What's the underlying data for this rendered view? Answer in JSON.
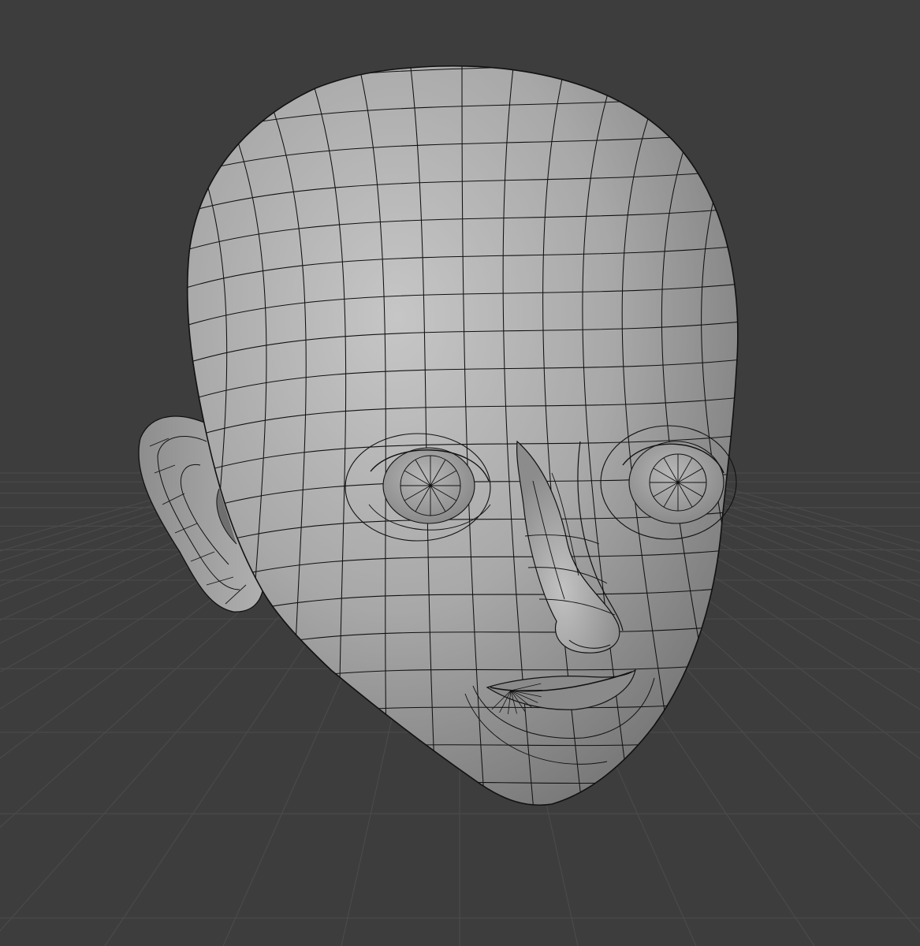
{
  "viewport": {
    "background_color": "#3d3d3d",
    "grid_color": "#4a4a4a",
    "mesh_base_color": "#a9a9a9",
    "mesh_highlight_color": "#c4c4c4",
    "mesh_shadow_color": "#7a7a7a",
    "wire_color": "#111111",
    "shading_mode": "solid",
    "overlay": "wireframe"
  },
  "object": {
    "icon": "head-mesh-icon"
  }
}
